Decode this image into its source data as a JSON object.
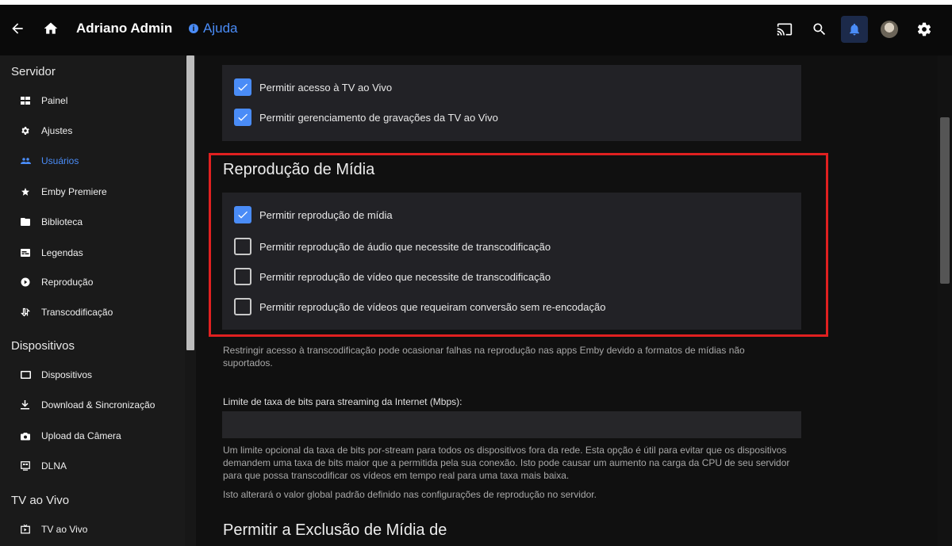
{
  "header": {
    "title": "Adriano Admin",
    "help_label": "Ajuda",
    "help_icon": "i"
  },
  "sidebar": {
    "sections": [
      {
        "label": "Servidor"
      },
      {
        "label": "Dispositivos"
      },
      {
        "label": "TV ao Vivo"
      }
    ],
    "items": [
      {
        "label": "Painel",
        "icon": "dashboard-icon"
      },
      {
        "label": "Ajustes",
        "icon": "gear-icon"
      },
      {
        "label": "Usuários",
        "icon": "users-icon",
        "active": true
      },
      {
        "label": "Emby Premiere",
        "icon": "star-icon"
      },
      {
        "label": "Biblioteca",
        "icon": "folder-icon"
      },
      {
        "label": "Legendas",
        "icon": "subtitles-icon"
      },
      {
        "label": "Reprodução",
        "icon": "play-circle-icon"
      },
      {
        "label": "Transcodificação",
        "icon": "transcode-icon"
      },
      {
        "label": "Dispositivos",
        "icon": "device-icon"
      },
      {
        "label": "Download & Sincronização",
        "icon": "download-icon"
      },
      {
        "label": "Upload da Câmera",
        "icon": "camera-icon"
      },
      {
        "label": "DLNA",
        "icon": "dlna-icon"
      },
      {
        "label": "TV ao Vivo",
        "icon": "tv-icon"
      }
    ]
  },
  "main": {
    "live_tv": {
      "checkboxes": [
        {
          "label": "Permitir acesso à TV ao Vivo",
          "checked": true
        },
        {
          "label": "Permitir gerenciamento de gravações da TV ao Vivo",
          "checked": true
        }
      ]
    },
    "playback": {
      "title": "Reprodução de Mídia",
      "checkboxes": [
        {
          "label": "Permitir reprodução de mídia",
          "checked": true
        },
        {
          "label": "Permitir reprodução de áudio que necessite de transcodificação",
          "checked": false
        },
        {
          "label": "Permitir reprodução de vídeo que necessite de transcodificação",
          "checked": false
        },
        {
          "label": "Permitir reprodução de vídeos que requeiram conversão sem re-encodação",
          "checked": false
        }
      ],
      "help_text": "Restringir acesso à transcodificação pode ocasionar falhas na reprodução nas apps Emby devido a formatos de mídias não suportados."
    },
    "bitrate": {
      "label": "Limite de taxa de bits para streaming da Internet (Mbps):",
      "value": "",
      "help_1": "Um limite opcional da taxa de bits por-stream para todos os dispositivos fora da rede. Esta opção é útil para evitar que os dispositivos demandem uma taxa de bits maior que a permitida pela sua conexão. Isto pode causar um aumento na carga da CPU de seu servidor para que possa transcodificar os vídeos em tempo real para uma taxa mais baixa.",
      "help_2": "Isto alterará o valor global padrão definido nas configurações de reprodução no servidor."
    },
    "deletion": {
      "title": "Permitir a Exclusão de Mídia de"
    }
  },
  "colors": {
    "accent": "#4a8cf7",
    "highlight_border": "#e02020"
  }
}
